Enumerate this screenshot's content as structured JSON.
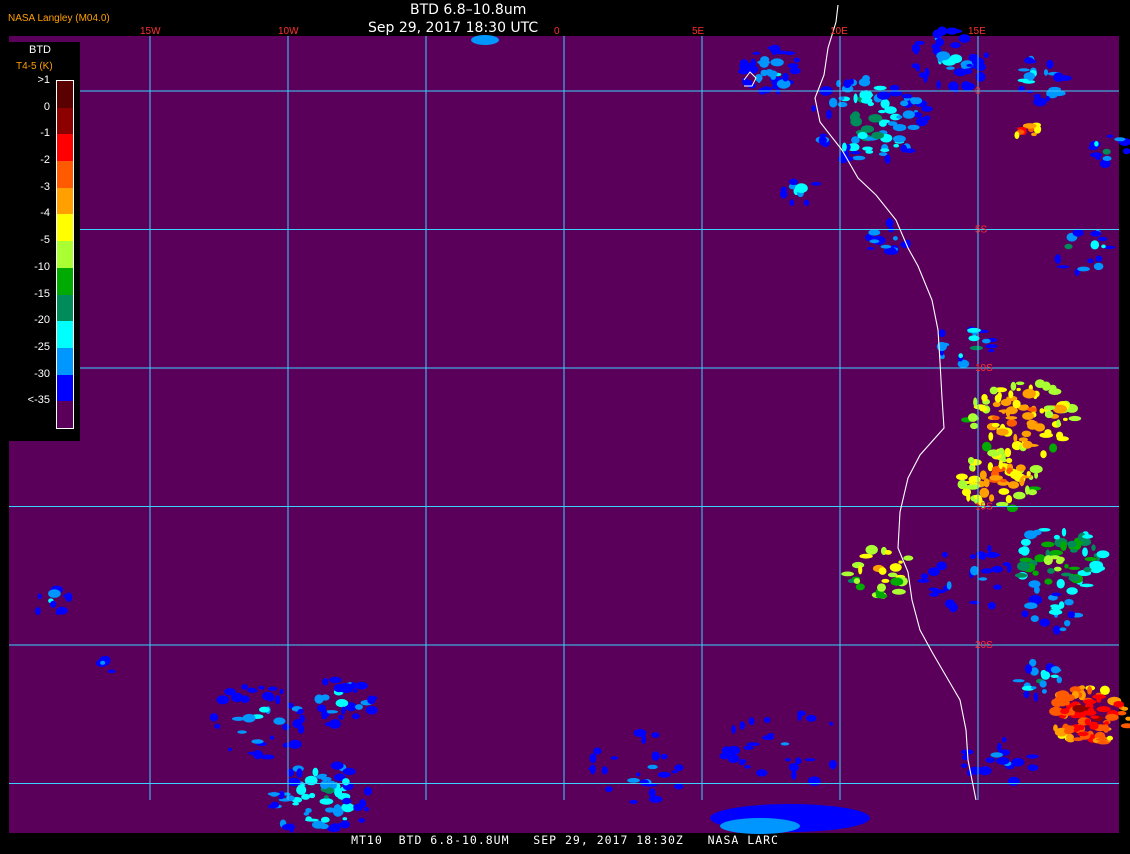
{
  "header": {
    "brand": "NASA Langley (M04.0)",
    "title": "BTD 6.8–10.8um",
    "timestamp": "Sep 29, 2017 18:30 UTC"
  },
  "footer": {
    "caption": "MT10  BTD 6.8-10.8UM   SEP 29, 2017 18:30Z   NASA LARC"
  },
  "legend": {
    "title": "BTD",
    "unit": "T4-5 (K)",
    "levels": [
      {
        "label": ">1",
        "color": "#5a0000"
      },
      {
        "label": "0",
        "color": "#8c0000"
      },
      {
        "label": "-1",
        "color": "#ff0000"
      },
      {
        "label": "-2",
        "color": "#ff5a00"
      },
      {
        "label": "-3",
        "color": "#ffa000"
      },
      {
        "label": "-4",
        "color": "#ffff00"
      },
      {
        "label": "-5",
        "color": "#aaff32"
      },
      {
        "label": "-10",
        "color": "#00aa00"
      },
      {
        "label": "-15",
        "color": "#008c5a"
      },
      {
        "label": "-20",
        "color": "#00ffff"
      },
      {
        "label": "-25",
        "color": "#0096ff"
      },
      {
        "label": "-30",
        "color": "#0000ff"
      },
      {
        "label": "<-35",
        "color": "#5a005a"
      }
    ]
  },
  "map": {
    "background_color": "#5a005a",
    "grid_color": "#3ad0ff",
    "coast_color": "#ffffff",
    "label_color": "#ff3030",
    "lon_labels": [
      {
        "label": "15W",
        "lon": -15
      },
      {
        "label": "10W",
        "lon": -10
      },
      {
        "label": "0",
        "lon": 0
      },
      {
        "label": "5E",
        "lon": 5
      },
      {
        "label": "10E",
        "lon": 10
      },
      {
        "label": "15E",
        "lon": 15
      }
    ],
    "lat_labels": [
      {
        "label": "0",
        "lat": 0
      },
      {
        "label": "5S",
        "lat": -5
      },
      {
        "label": "10S",
        "lat": -10
      },
      {
        "label": "15S",
        "lat": -15
      },
      {
        "label": "20S",
        "lat": -20
      }
    ]
  }
}
